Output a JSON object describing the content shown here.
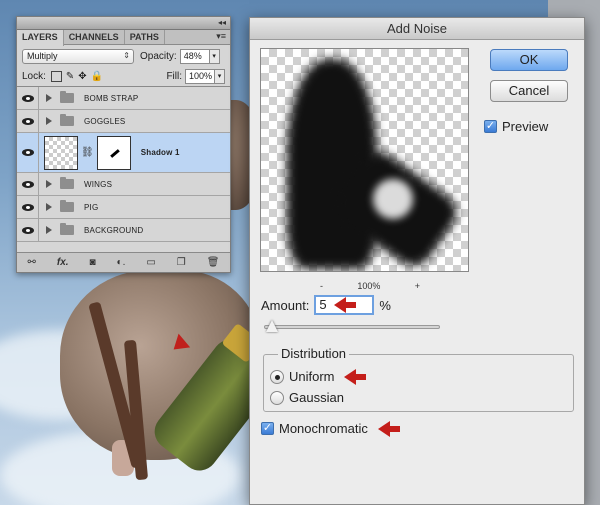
{
  "layers_panel": {
    "tabs": [
      "LAYERS",
      "CHANNELS",
      "PATHS"
    ],
    "blend_mode": "Multiply",
    "opacity_label": "Opacity:",
    "opacity_value": "48%",
    "lock_label": "Lock:",
    "fill_label": "Fill:",
    "fill_value": "100%",
    "layers": [
      {
        "name": "BOMB STRAP",
        "type": "group"
      },
      {
        "name": "GOGGLES",
        "type": "group"
      },
      {
        "name": "Shadow 1",
        "type": "layer",
        "selected": true
      },
      {
        "name": "WINGS",
        "type": "group"
      },
      {
        "name": "PIG",
        "type": "group"
      },
      {
        "name": "BACKGROUND",
        "type": "group"
      }
    ],
    "bottom_icons": [
      "link-icon",
      "fx-icon",
      "mask-icon",
      "adjustment-icon",
      "folder-icon",
      "new-layer-icon",
      "trash-icon"
    ]
  },
  "dialog": {
    "title": "Add Noise",
    "ok_label": "OK",
    "cancel_label": "Cancel",
    "preview_label": "Preview",
    "preview_checked": true,
    "zoom_minus": "-",
    "zoom_value": "100%",
    "zoom_plus": "+",
    "amount_label": "Amount:",
    "amount_value": "5",
    "amount_unit": "%",
    "distribution_label": "Distribution",
    "uniform_label": "Uniform",
    "gaussian_label": "Gaussian",
    "selected_distribution": "Uniform",
    "monochromatic_label": "Monochromatic",
    "monochromatic_checked": true
  },
  "colors": {
    "annotation_arrow": "#c41e1a",
    "selected_layer": "#bcd5f3",
    "default_button": "#6ea8ee"
  }
}
